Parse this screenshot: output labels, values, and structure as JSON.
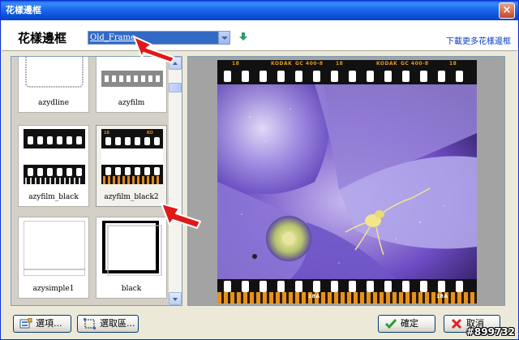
{
  "window": {
    "title": "花樣邊框",
    "close": "×"
  },
  "header": {
    "title": "花樣邊框",
    "selected_frame": "Old_Frame",
    "more_link": "下載更多花樣邊框"
  },
  "thumbnails": [
    {
      "label": "azydline"
    },
    {
      "label": "azyfilm"
    },
    {
      "label": "azyfilm_black"
    },
    {
      "label": "azyfilm_black2",
      "selected": true
    },
    {
      "label": "azysimple1"
    },
    {
      "label": "black"
    }
  ],
  "preview": {
    "film_top": [
      "18",
      "KODAK",
      "GC 400-8",
      "18",
      "KODAK",
      "GC 400-8",
      "18"
    ],
    "film_bottom": [
      "18A",
      "18A"
    ]
  },
  "buttons": {
    "options": "選項...",
    "select_area": "選取區...",
    "ok": "確定",
    "cancel": "取消"
  },
  "watermark": "#899732",
  "colors": {
    "titlebar": "#0a4fd6",
    "selection": "#316ac5",
    "annotation_arrow": "#e01818",
    "film_orange": "#e08a1e"
  },
  "icons": [
    "close-icon",
    "download-arrow-icon",
    "options-icon",
    "select-area-icon",
    "checkmark-icon",
    "x-icon"
  ]
}
